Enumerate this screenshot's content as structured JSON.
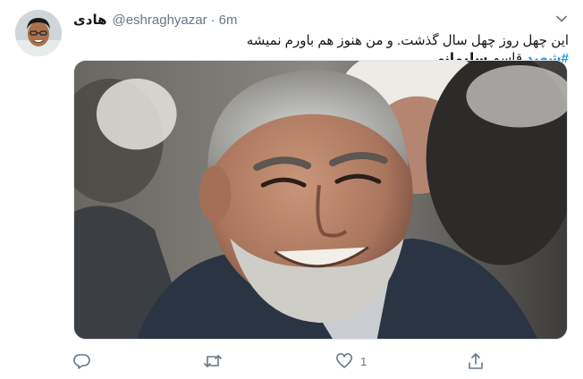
{
  "tweet": {
    "display_name": "هادی",
    "handle": "@eshraghyazar",
    "separator": "·",
    "time": "6m",
    "text_line1": "این چهل روز چهل سال گذشت. و من هنوز هم باورم نمیشه",
    "hashtag": "#شهید",
    "text_mid": "قاسم",
    "text_bold": "سلیمانی",
    "like_count": "1"
  },
  "icons": {
    "caret": "chevron-down-icon",
    "reply": "reply-icon",
    "retweet": "retweet-icon",
    "like": "heart-icon",
    "share": "share-icon"
  },
  "colors": {
    "link": "#1b95e0",
    "secondary_text": "#657786",
    "primary_text": "#14171a"
  }
}
